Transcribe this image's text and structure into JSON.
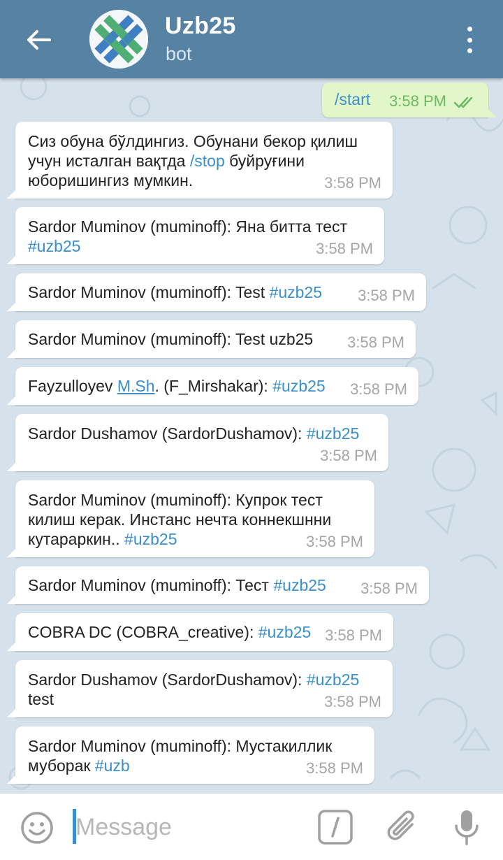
{
  "header": {
    "title": "Uzb25",
    "subtitle": "bot"
  },
  "outgoing": {
    "text": "/start",
    "time": "3:58 PM"
  },
  "messages": [
    {
      "p1": "Сиз обуна бўлдингиз. Обунани бекор қилиш учун исталган вақтда ",
      "cmd": "/stop",
      "p2": " буйруғини юборишингиз мумкин.",
      "time": "3:58 PM"
    },
    {
      "p1": "Sardor Muminov (muminoff): Яна битта тест ",
      "tag": "#uzb25",
      "time": "3:58 PM"
    },
    {
      "p1": "Sardor Muminov (muminoff): Test ",
      "tag": "#uzb25",
      "time": "3:58 PM"
    },
    {
      "p1": "Sardor Muminov (muminoff): Test uzb25",
      "time": "3:58 PM"
    },
    {
      "p1": "Fayzulloyev ",
      "link": "M.Sh",
      "p2": ". (F_Mirshakar): ",
      "tag": "#uzb25",
      "time": "3:58 PM"
    },
    {
      "p1": "Sardor Dushamov (SardorDushamov): ",
      "tag": "#uzb25",
      "time": "3:58 PM"
    },
    {
      "p1": "Sardor Muminov (muminoff): Купрок тест килиш керак. Инстанс нечта коннекшнни кутараркин.. ",
      "tag": "#uzb25",
      "time": "3:58 PM"
    },
    {
      "p1": "Sardor Muminov (muminoff): Тест ",
      "tag": "#uzb25",
      "time": "3:58 PM"
    },
    {
      "p1": "COBRA DC (COBRA_creative): ",
      "tag": "#uzb25",
      "time": "3:58 PM"
    },
    {
      "p1": "Sardor Dushamov (SardorDushamov): ",
      "tag": "#uzb25",
      "p2": " test",
      "time": "3:58 PM"
    },
    {
      "p1": "Sardor Muminov (muminoff): Мустакиллик муборак ",
      "tag": "#uzb",
      "time": "3:58 PM"
    }
  ],
  "composer": {
    "placeholder": "Message"
  },
  "colors": {
    "header": "#5682a3",
    "chat_bg": "#d5e2eb",
    "outgoing_bubble": "#e1f7c9",
    "incoming_bubble": "#ffffff",
    "link": "#3a8fcb",
    "timestamp": "#a6a6a6",
    "outgoing_timestamp": "#6cb867",
    "read_check": "#6cb867"
  },
  "icons": {
    "back": "arrow-left-icon",
    "menu": "more-vertical-icon",
    "emoji": "smiley-icon",
    "bot_command": "slash-command-icon",
    "attach": "paperclip-icon",
    "voice": "microphone-icon",
    "read_status": "double-check-icon"
  }
}
